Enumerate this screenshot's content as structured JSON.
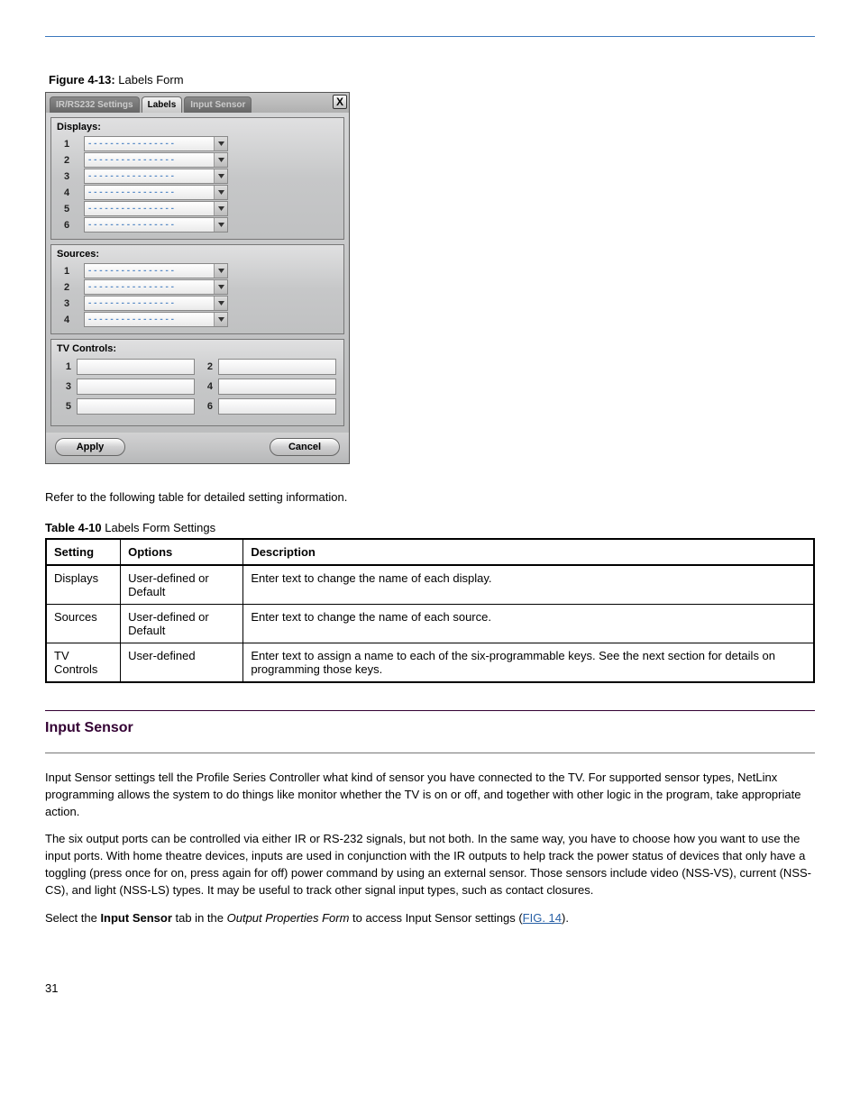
{
  "figure_caption_title": "Figure 4-13:",
  "figure_caption_text": " Labels Form",
  "dialog": {
    "tabs": [
      "IR/RS232 Settings",
      "Labels",
      "Input Sensor"
    ],
    "close": "X",
    "groups": {
      "displays": {
        "label": "Displays:",
        "rows": [
          "1",
          "2",
          "3",
          "4",
          "5",
          "6"
        ],
        "placeholder": "- - - - - - - - - - - - - - - -"
      },
      "sources": {
        "label": "Sources:",
        "rows": [
          "1",
          "2",
          "3",
          "4"
        ],
        "placeholder": "- - - - - - - - - - - - - - - -"
      },
      "tvcontrols": {
        "label": "TV Controls:",
        "cells": [
          "1",
          "2",
          "3",
          "4",
          "5",
          "6"
        ]
      }
    },
    "buttons": {
      "apply": "Apply",
      "cancel": "Cancel"
    }
  },
  "below_fig_para": "Refer to the following table for detailed setting information.",
  "table_caption_title": "Table 4-10",
  "table_caption_text": " Labels Form Settings",
  "table": {
    "headers": [
      "Setting",
      "Options",
      "Description"
    ],
    "rows": [
      [
        "Displays",
        "User-defined or Default",
        "Enter text to change the name of each display."
      ],
      [
        "Sources",
        "User-defined or Default",
        "Enter text to change the name of each source."
      ],
      [
        "TV Controls",
        "User-defined",
        "Enter text to assign a name to each of the six-programmable keys. See the next section for details on programming those keys."
      ]
    ]
  },
  "section_title": "Input Sensor",
  "paras": [
    "Input Sensor settings tell the Profile Series Controller what kind of sensor you have connected to the TV. For supported sensor types, NetLinx programming allows the system to do things like monitor whether the TV is on or off, and together with other logic in the program, take appropriate action.",
    "The six output ports can be controlled via either IR or RS-232 signals, but not both. In the same way, you have to choose how you want to use the input ports. With home theatre devices, inputs are used in conjunction with the IR outputs to help track the power status of devices that only have a toggling (press once for on, press again for off) power command by using an external sensor. Those sensors include video (NSS-VS), current (NSS-CS), and light (NSS-LS) types. It may be useful to track other signal input types, such as contact closures."
  ],
  "see_para_prefix": "Select the ",
  "see_para_bold": "Input Sensor",
  "see_para_mid": " tab in the ",
  "see_para_italic": "Output Properties Form",
  "see_para_tail": " to access Input Sensor settings (",
  "see_link": "FIG. 14",
  "see_close": ").",
  "page_number": "31"
}
